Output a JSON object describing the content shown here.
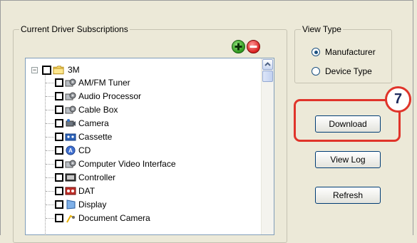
{
  "subscriptions": {
    "group_label": "Current Driver Subscriptions",
    "add_icon": "plus-circle-green",
    "remove_icon": "minus-circle-red",
    "tree": {
      "root": {
        "label": "3M",
        "expander": "−",
        "icon": "folder-icon"
      },
      "items": [
        {
          "label": "AM/FM Tuner",
          "icon": "device-gear-icon"
        },
        {
          "label": "Audio Processor",
          "icon": "device-gear-icon"
        },
        {
          "label": "Cable Box",
          "icon": "device-gear-icon"
        },
        {
          "label": "Camera",
          "icon": "camera-icon"
        },
        {
          "label": "Cassette",
          "icon": "cassette-icon"
        },
        {
          "label": "CD",
          "icon": "cd-icon"
        },
        {
          "label": "Computer Video Interface",
          "icon": "device-gear-icon"
        },
        {
          "label": "Controller",
          "icon": "controller-icon"
        },
        {
          "label": "DAT",
          "icon": "dat-icon"
        },
        {
          "label": "Display",
          "icon": "display-icon"
        },
        {
          "label": "Document Camera",
          "icon": "document-camera-icon"
        }
      ]
    }
  },
  "view_type": {
    "group_label": "View Type",
    "options": [
      {
        "label": "Manufacturer",
        "selected": true
      },
      {
        "label": "Device Type",
        "selected": false
      }
    ]
  },
  "buttons": {
    "download": "Download",
    "view_log": "View Log",
    "refresh": "Refresh"
  },
  "callout": {
    "number": "7",
    "color": "#e0342a"
  }
}
